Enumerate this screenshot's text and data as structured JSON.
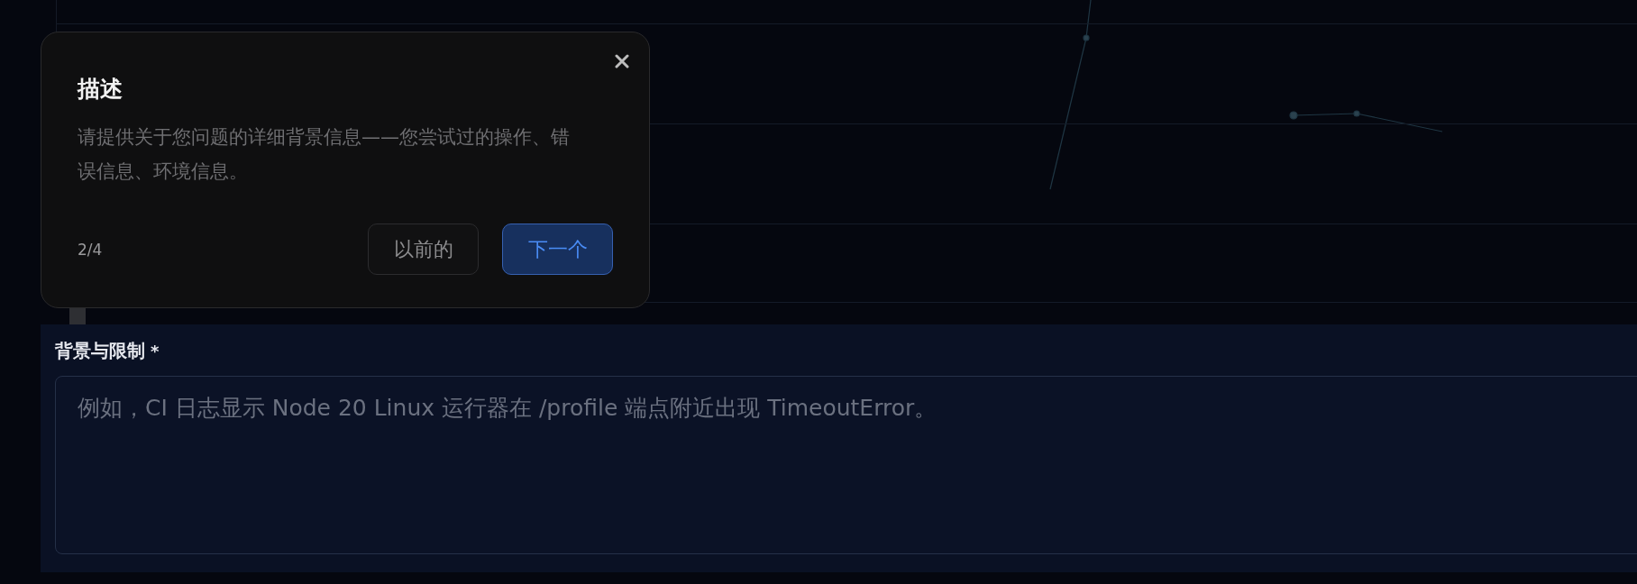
{
  "tour_popover": {
    "title": "描述",
    "description": "请提供关于您问题的详细背景信息——您尝试过的操作、错误信息、环境信息。",
    "step": "2/4",
    "buttons": [
      {
        "kind": "secondary",
        "label": "以前的"
      },
      {
        "kind": "primary",
        "label": "下一个"
      }
    ]
  },
  "background_field": {
    "label": "背景与限制",
    "required_mark": "*",
    "placeholder": "例如，CI 日志显示 Node 20 Linux 运行器在 /profile 端点附近出现 TimeoutError。"
  }
}
